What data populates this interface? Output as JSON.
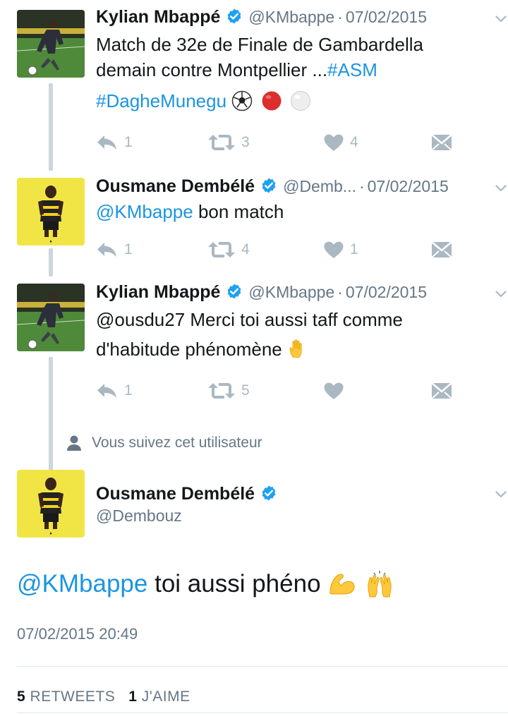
{
  "colors": {
    "link": "#1b95e0",
    "verified": "#1da1f2",
    "meta": "#657786",
    "action": "#aab8c2",
    "thread_line": "#ccd6dd"
  },
  "thread": [
    {
      "author_name": "Kylian Mbappé",
      "handle": "@KMbappe",
      "date": "07/02/2015",
      "text_line1": "Match de 32e de Finale de Gambardella",
      "text_line2": "demain contre Montpellier ...",
      "hashtag1": "#ASM",
      "hashtag2": "#DagheMunegu",
      "emojis": [
        "soccer-ball",
        "red-circle",
        "white-circle"
      ],
      "reply_count": "1",
      "retweet_count": "3",
      "like_count": "4"
    },
    {
      "author_name": "Ousmane Dembélé",
      "handle": "@Dembouz",
      "handle_display": "@Demb...",
      "date": "07/02/2015",
      "mention": "@KMbappe",
      "text": "bon match",
      "reply_count": "1",
      "retweet_count": "4",
      "like_count": "1"
    },
    {
      "author_name": "Kylian Mbappé",
      "handle": "@KMbappe",
      "date": "07/02/2015",
      "text_line1": "@ousdu27 Merci toi aussi taff comme",
      "text_line2": "d'habitude phénomène",
      "emojis": [
        "raised-hand"
      ],
      "reply_count": "1",
      "retweet_count": "5",
      "like_count": ""
    }
  ],
  "follow_notice": "Vous suivez cet utilisateur",
  "focused": {
    "author_name": "Ousmane Dembélé",
    "handle": "@Dembouz",
    "mention": "@KMbappe",
    "text": "toi aussi phéno",
    "emojis": [
      "flexed-biceps",
      "raising-hands"
    ],
    "timestamp": "07/02/2015 20:49",
    "retweets_count": "5",
    "retweets_label": "RETWEETS",
    "likes_count": "1",
    "likes_label": "J'AIME"
  }
}
